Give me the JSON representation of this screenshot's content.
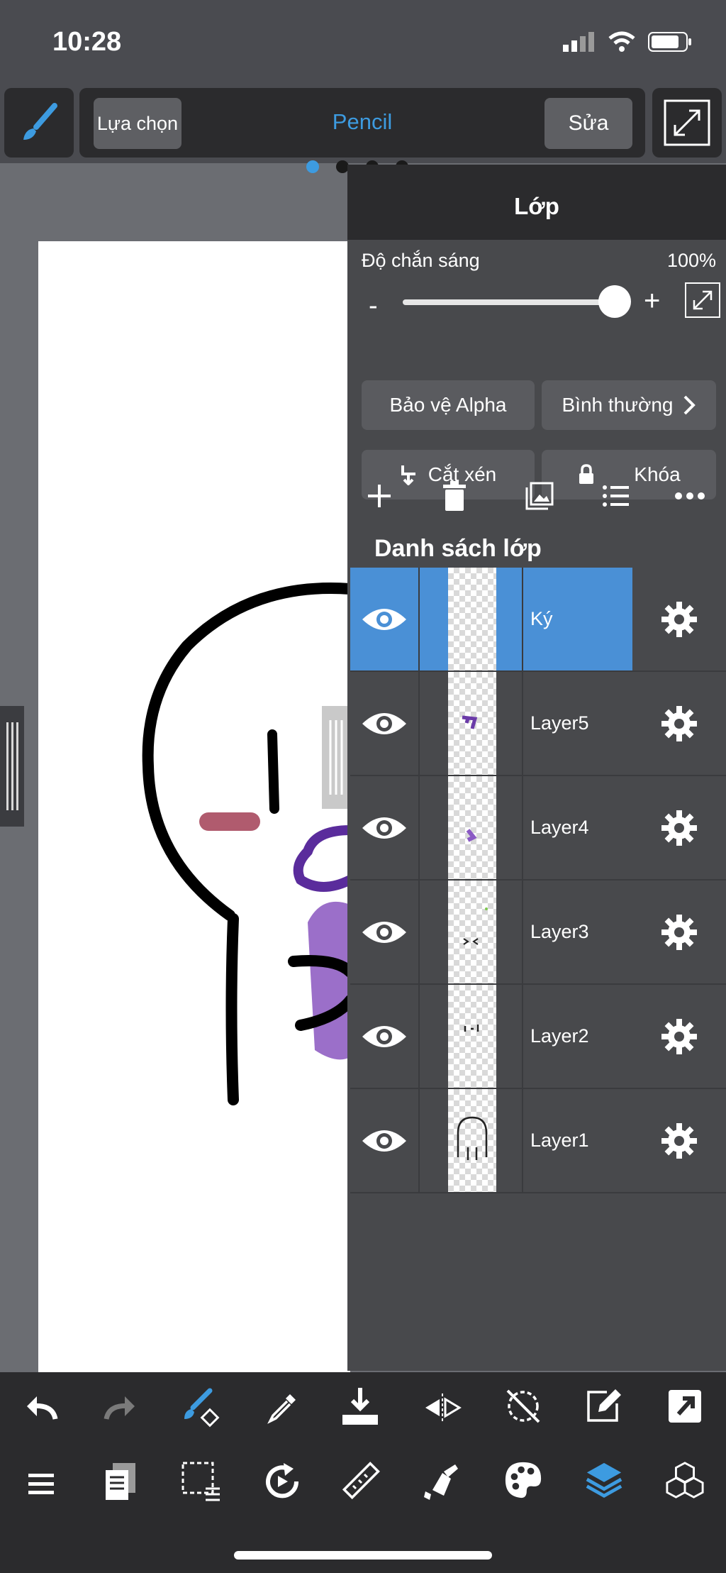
{
  "status": {
    "time": "10:28"
  },
  "toolbar": {
    "select_label": "Lựa chọn",
    "tool_name": "Pencil",
    "edit_label": "Sửa",
    "brush_icon": "brush-icon",
    "expand_icon": "expand-icon"
  },
  "pager": {
    "page_count": 4,
    "active_index": 0
  },
  "panel": {
    "title": "Lớp",
    "opacity_label": "Độ chắn sáng",
    "opacity_value": "100%",
    "minus": "-",
    "plus": "+",
    "alpha_protect": "Bảo vệ Alpha",
    "blend_mode": "Bình thường",
    "clipping": "Cắt xén",
    "lock": "Khóa",
    "list_title": "Danh sách lớp"
  },
  "layers": [
    {
      "name": "Ký",
      "selected": true
    },
    {
      "name": "Layer5",
      "selected": false
    },
    {
      "name": "Layer4",
      "selected": false
    },
    {
      "name": "Layer3",
      "selected": false
    },
    {
      "name": "Layer2",
      "selected": false
    },
    {
      "name": "Layer1",
      "selected": false
    }
  ],
  "colors": {
    "accent": "#3d9be0",
    "selected_row": "#4a90d6",
    "panel_bg": "#48494c",
    "bar_bg": "#2b2b2d"
  }
}
